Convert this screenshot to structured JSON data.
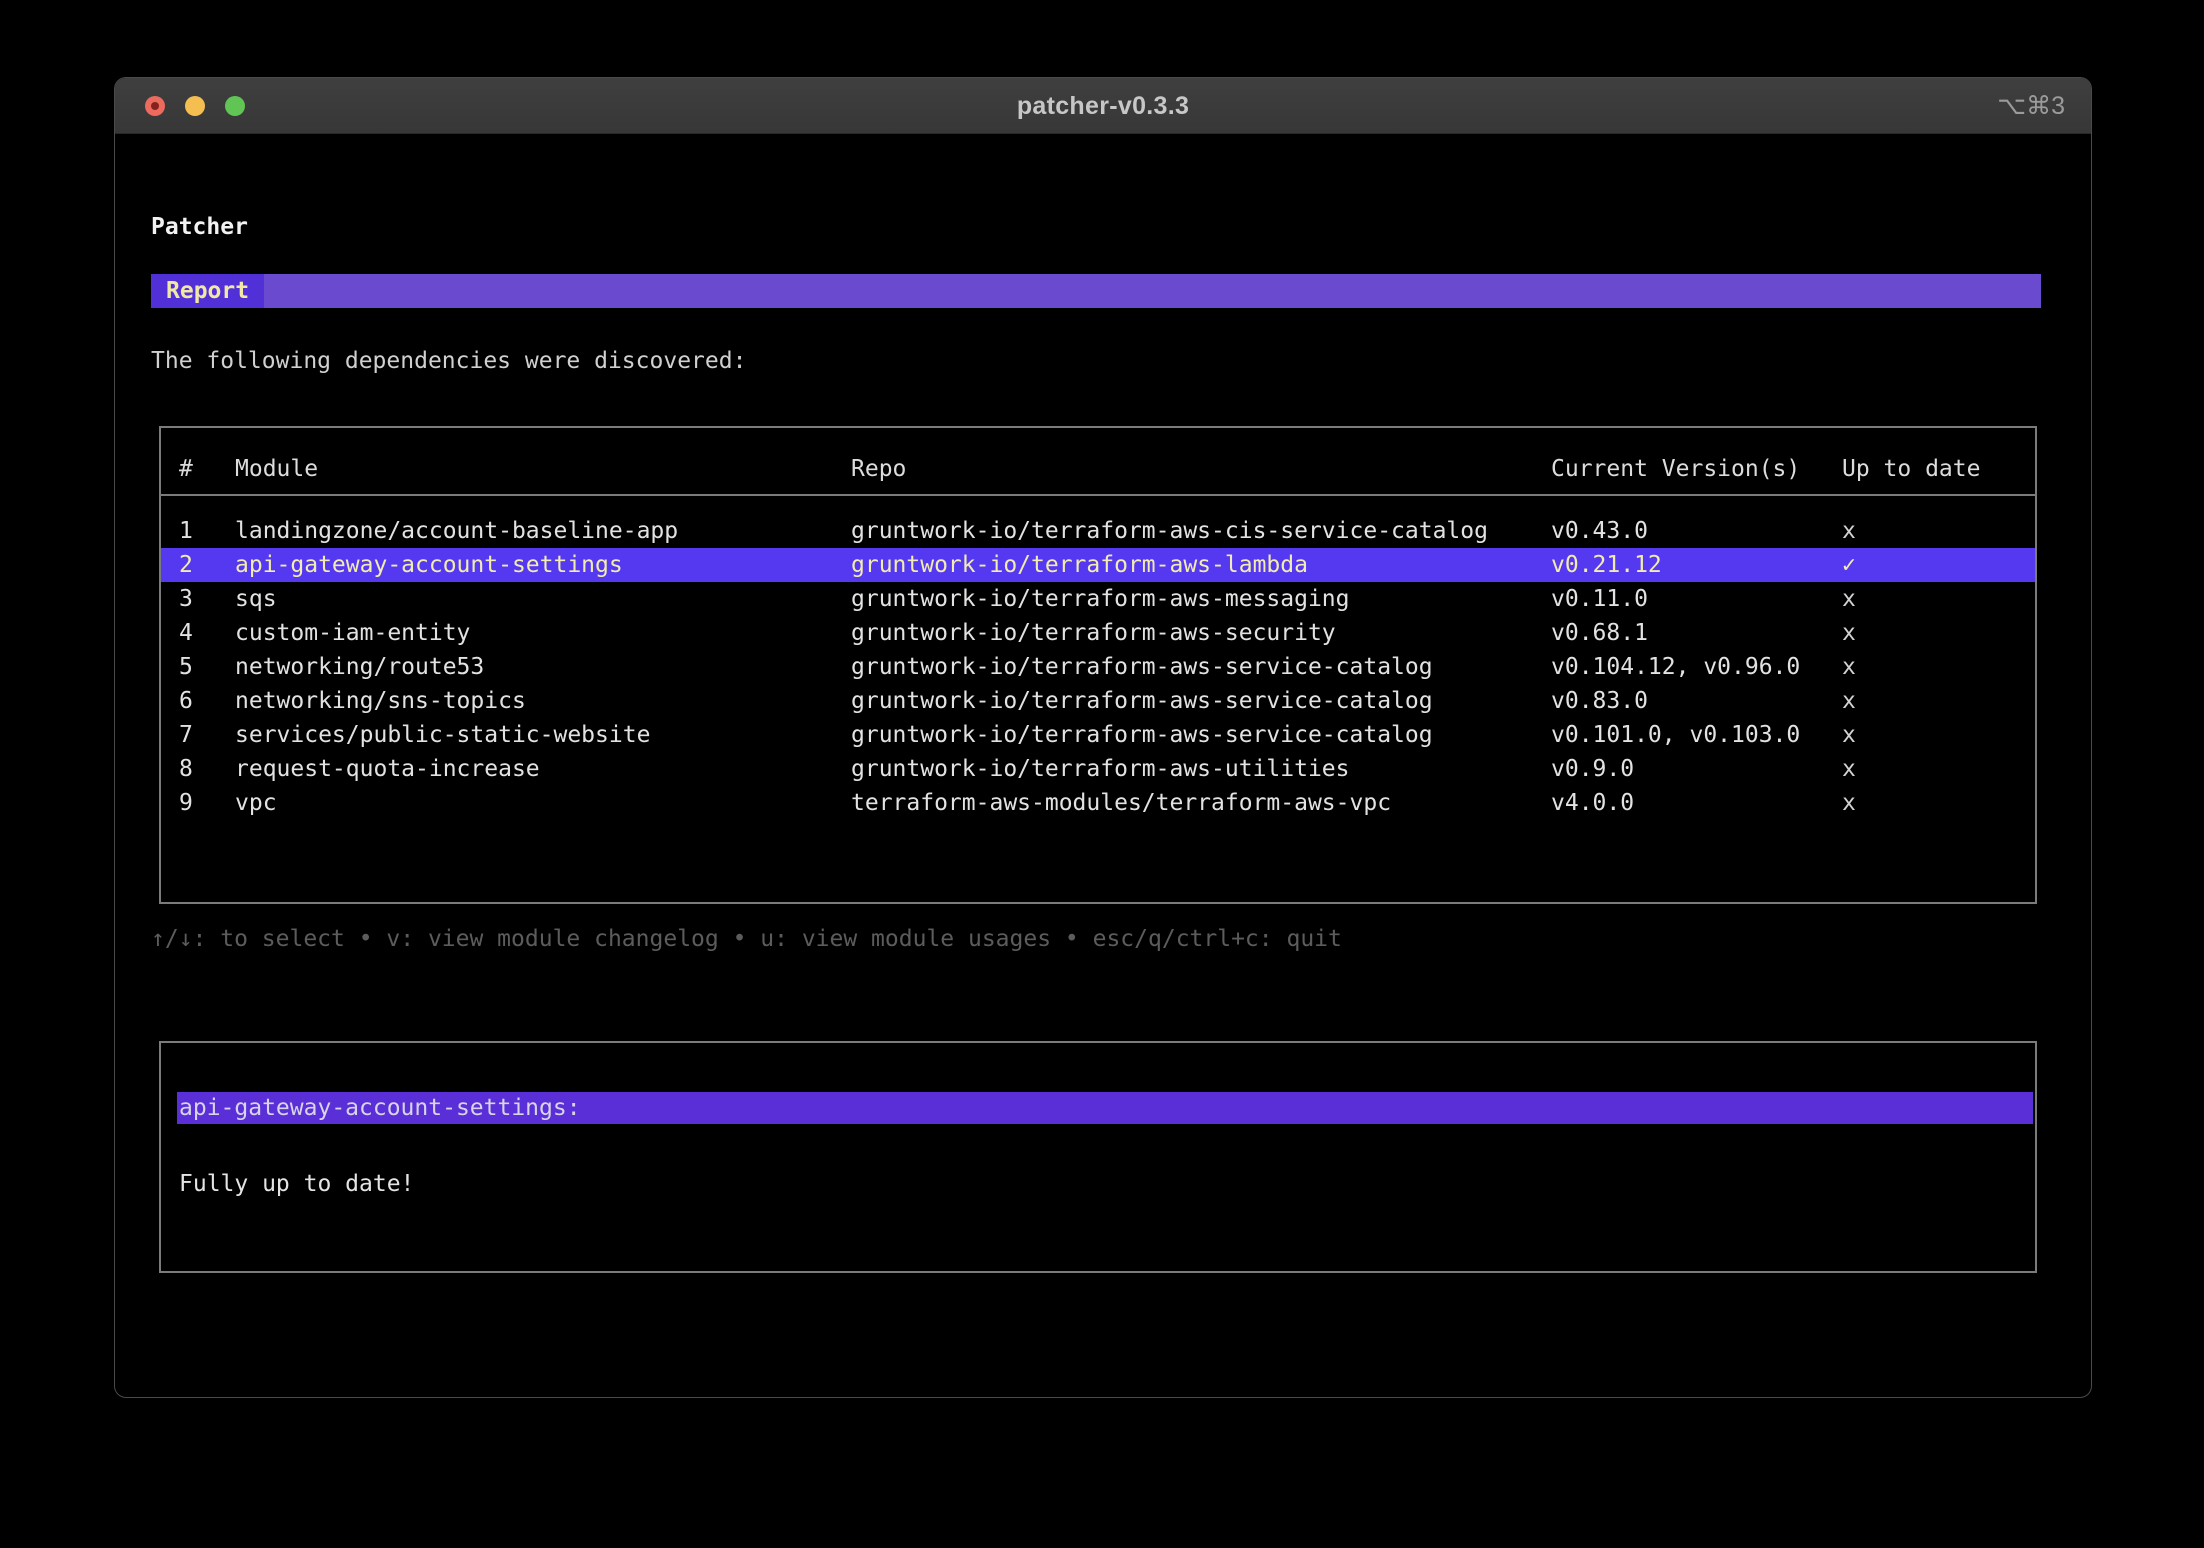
{
  "window": {
    "title": "patcher-v0.3.3",
    "shortcut": "⌥⌘3",
    "traffic_lights": [
      "close",
      "minimize",
      "zoom"
    ]
  },
  "app": {
    "heading": "Patcher",
    "tab_label": "Report",
    "intro": "The following dependencies were discovered:",
    "help": "↑/↓: to select • v: view module changelog • u: view module usages • esc/q/ctrl+c: quit"
  },
  "table": {
    "columns": {
      "num": "#",
      "module": "Module",
      "repo": "Repo",
      "version": "Current Version(s)",
      "up_to_date": "Up to date"
    },
    "rows": [
      {
        "num": "1",
        "module": "landingzone/account-baseline-app",
        "repo": "gruntwork-io/terraform-aws-cis-service-catalog",
        "version": "v0.43.0",
        "up_to_date": "x",
        "selected": false
      },
      {
        "num": "2",
        "module": "api-gateway-account-settings",
        "repo": "gruntwork-io/terraform-aws-lambda",
        "version": "v0.21.12",
        "up_to_date": "✓",
        "selected": true
      },
      {
        "num": "3",
        "module": "sqs",
        "repo": "gruntwork-io/terraform-aws-messaging",
        "version": "v0.11.0",
        "up_to_date": "x",
        "selected": false
      },
      {
        "num": "4",
        "module": "custom-iam-entity",
        "repo": "gruntwork-io/terraform-aws-security",
        "version": "v0.68.1",
        "up_to_date": "x",
        "selected": false
      },
      {
        "num": "5",
        "module": "networking/route53",
        "repo": "gruntwork-io/terraform-aws-service-catalog",
        "version": "v0.104.12, v0.96.0",
        "up_to_date": "x",
        "selected": false
      },
      {
        "num": "6",
        "module": "networking/sns-topics",
        "repo": "gruntwork-io/terraform-aws-service-catalog",
        "version": "v0.83.0",
        "up_to_date": "x",
        "selected": false
      },
      {
        "num": "7",
        "module": "services/public-static-website",
        "repo": "gruntwork-io/terraform-aws-service-catalog",
        "version": "v0.101.0, v0.103.0",
        "up_to_date": "x",
        "selected": false
      },
      {
        "num": "8",
        "module": "request-quota-increase",
        "repo": "gruntwork-io/terraform-aws-utilities",
        "version": "v0.9.0",
        "up_to_date": "x",
        "selected": false
      },
      {
        "num": "9",
        "module": "vpc",
        "repo": "terraform-aws-modules/terraform-aws-vpc",
        "version": "v4.0.0",
        "up_to_date": "x",
        "selected": false
      }
    ]
  },
  "detail": {
    "title": "api-gateway-account-settings:",
    "body": "Fully up to date!"
  },
  "colors": {
    "selected_row_bg": "#5539f0",
    "selected_row_text": "#f2ecb0",
    "report_tab_bg": "#5230d8",
    "report_tab_text": "#f0e9a6",
    "report_bar_bg": "#6a4bd0",
    "detail_bar_bg": "#5a2fd8",
    "detail_bar_text": "#d8d4e6",
    "table_border": "#7b7b7b",
    "help_text": "#5c5c5c",
    "titlebar_bg": "#3a3a3a",
    "traffic_red": "#ec6a5e",
    "traffic_yellow": "#f4bf50",
    "traffic_green": "#61c555"
  }
}
